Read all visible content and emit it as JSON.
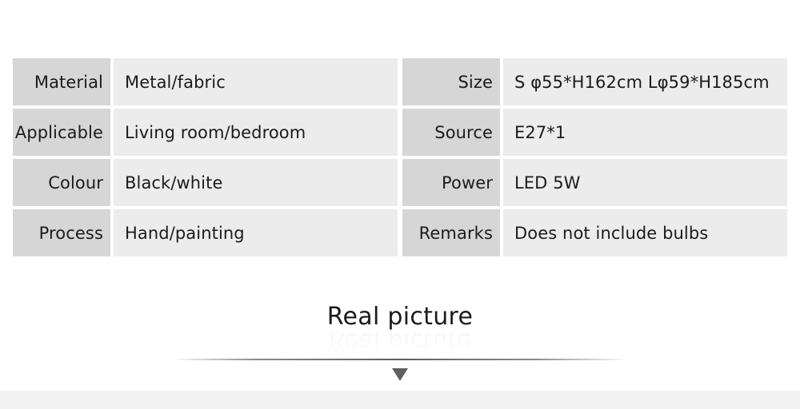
{
  "spec": {
    "left_table": [
      {
        "label": "Material",
        "value": "Metal/fabric"
      },
      {
        "label": "Applicable",
        "value": "Living room/bedroom"
      },
      {
        "label": "Colour",
        "value": "Black/white"
      },
      {
        "label": "Process",
        "value": "Hand/painting"
      }
    ],
    "right_table": [
      {
        "label": "Size",
        "value": "S φ55*H162cm Lφ59*H185cm"
      },
      {
        "label": "Source",
        "value": "E27*1"
      },
      {
        "label": "Power",
        "value": "LED 5W"
      },
      {
        "label": "Remarks",
        "value": "Does not include bulbs"
      }
    ]
  },
  "real_picture": {
    "heading": "Real picture",
    "reflection": "Real picture",
    "arrow_icon": "chevron-down-triangle-icon"
  },
  "colors": {
    "page_background": "#ffffff",
    "label_cell": "#d6d6d6",
    "value_cell": "#ececec",
    "text": "#1b1b1b",
    "divider": "#555555",
    "arrow": "#5f5f5f",
    "bottom_strip": "#f2f2f2"
  }
}
